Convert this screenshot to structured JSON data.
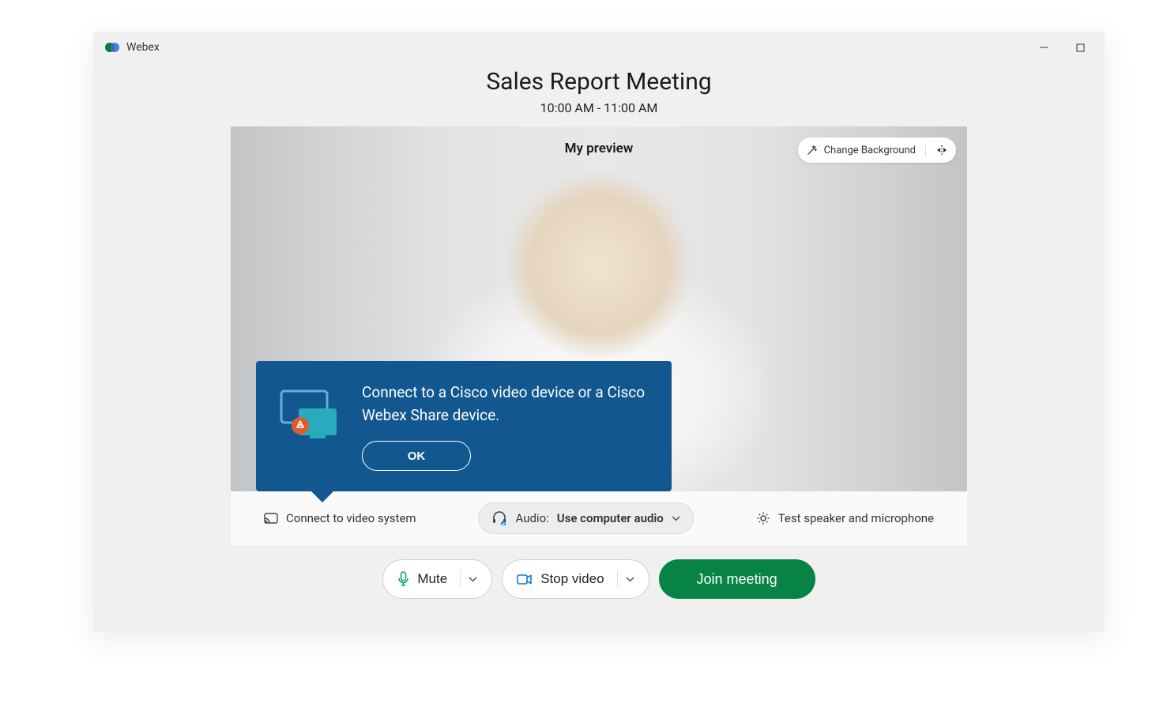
{
  "window": {
    "app_name": "Webex"
  },
  "meeting": {
    "title": "Sales Report Meeting",
    "time": "10:00 AM - 11:00 AM"
  },
  "preview": {
    "label": "My preview",
    "change_bg": "Change Background"
  },
  "callout": {
    "text": "Connect to a Cisco video device or a Cisco Webex Share device.",
    "ok": "OK"
  },
  "options": {
    "connect": "Connect to video system",
    "audio_label": "Audio:",
    "audio_value": "Use computer audio",
    "test": "Test speaker and microphone"
  },
  "actions": {
    "mute": "Mute",
    "stop_video": "Stop video",
    "join": "Join meeting"
  }
}
